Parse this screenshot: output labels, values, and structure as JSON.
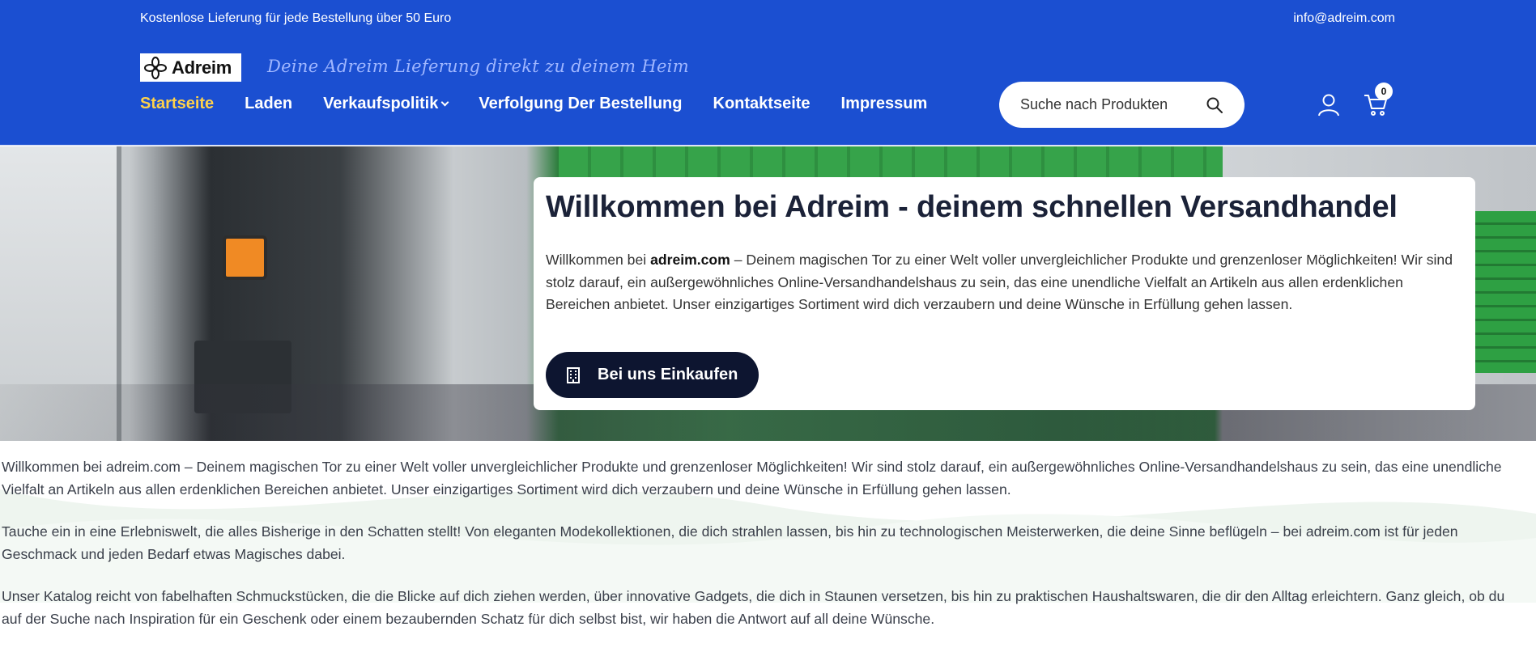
{
  "topbar": {
    "shipping_notice": "Kostenlose Lieferung für jede Bestellung über 50 Euro",
    "email": "info@adreim.com"
  },
  "brand": {
    "logo_text": "Adreim",
    "tagline": "Deine Adreim Lieferung direkt zu deinem Heim"
  },
  "nav": {
    "items": [
      {
        "label": "Startseite",
        "active": true
      },
      {
        "label": "Laden"
      },
      {
        "label": "Verkaufspolitik",
        "has_dropdown": true
      },
      {
        "label": "Verfolgung Der Bestellung"
      },
      {
        "label": "Kontaktseite"
      },
      {
        "label": "Impressum"
      }
    ]
  },
  "search": {
    "placeholder": "Suche nach Produkten",
    "icon": "search-icon"
  },
  "cart": {
    "count": "0",
    "icon": "cart-icon"
  },
  "account": {
    "icon": "user-icon"
  },
  "hero": {
    "title": "Willkommen bei Adreim - deinem schnellen Versandhandel",
    "text_before": "Willkommen bei ",
    "text_bold": "adreim.com",
    "text_after": " – Deinem magischen Tor zu einer Welt voller unvergleichlicher Produkte und grenzenloser Möglichkeiten! Wir sind stolz darauf, ein außergewöhnliches Online-Versandhandelshaus zu sein, das eine unendliche Vielfalt an Artikeln aus allen erdenklichen Bereichen anbietet. Unser einzigartiges Sortiment wird dich verzaubern und deine Wünsche in Erfüllung gehen lassen.",
    "button_label": "Bei uns Einkaufen",
    "button_icon": "building-icon"
  },
  "content": {
    "paragraphs": [
      "Willkommen bei adreim.com – Deinem magischen Tor zu einer Welt voller unvergleichlicher Produkte und grenzenloser Möglichkeiten! Wir sind stolz darauf, ein außergewöhnliches Online-Versandhandelshaus zu sein, das eine unendliche Vielfalt an Artikeln aus allen erdenklichen Bereichen anbietet. Unser einzigartiges Sortiment wird dich verzaubern und deine Wünsche in Erfüllung gehen lassen.",
      "Tauche ein in eine Erlebniswelt, die alles Bisherige in den Schatten stellt! Von eleganten Modekollektionen, die dich strahlen lassen, bis hin zu technologischen Meisterwerken, die deine Sinne beflügeln – bei adreim.com ist für jeden Geschmack und jeden Bedarf etwas Magisches dabei.",
      "Unser Katalog reicht von fabelhaften Schmuckstücken, die die Blicke auf dich ziehen werden, über innovative Gadgets, die dich in Staunen versetzen, bis hin zu praktischen Haushaltswaren, die dir den Alltag erleichtern. Ganz gleich, ob du auf der Suche nach Inspiration für ein Geschenk oder einem bezaubernden Schatz für dich selbst bist, wir haben die Antwort auf all deine Wünsche."
    ]
  },
  "colors": {
    "header_bg": "#1b4fd1",
    "nav_active": "#ffd24a",
    "button_bg": "#0d1530"
  }
}
